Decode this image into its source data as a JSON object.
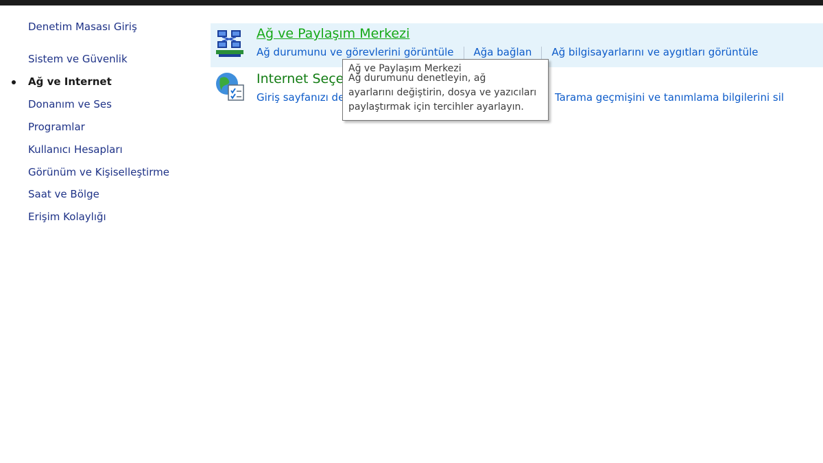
{
  "sidebar": {
    "home": "Denetim Masası Giriş",
    "items": [
      {
        "label": "Sistem ve Güvenlik"
      },
      {
        "label": "Ağ ve Internet"
      },
      {
        "label": "Donanım ve Ses"
      },
      {
        "label": "Programlar"
      },
      {
        "label": "Kullanıcı Hesapları"
      },
      {
        "label": "Görünüm ve Kişiselleştirme"
      },
      {
        "label": "Saat ve Bölge"
      },
      {
        "label": "Erişim Kolaylığı"
      }
    ]
  },
  "categories": [
    {
      "title": "Ağ ve Paylaşım Merkezi",
      "icon": "network-sharing-icon",
      "links": [
        "Ağ durumunu ve görevlerini görüntüle",
        "Ağa bağlan",
        "Ağ bilgisayarlarını ve aygıtları görüntüle"
      ]
    },
    {
      "title": "Internet Seçe",
      "icon": "internet-options-icon",
      "links": [
        "Giriş sayfanızı de",
        "Tarama geçmişini ve tanımlama bilgilerini sil"
      ]
    }
  ],
  "tooltip": {
    "lines": [
      "Ağ ve Paylaşım Merkezi",
      "Ağ durumunu denetleyin, ağ",
      "ayarlarını değiştirin, dosya ve yazıcıları",
      "paylaştırmak için tercihler ayarlayın."
    ]
  },
  "colors": {
    "category_title": "#127c13",
    "category_title_hover": "#16a816",
    "link": "#0d5bc9",
    "highlight_bg": "#e5f3fb"
  }
}
